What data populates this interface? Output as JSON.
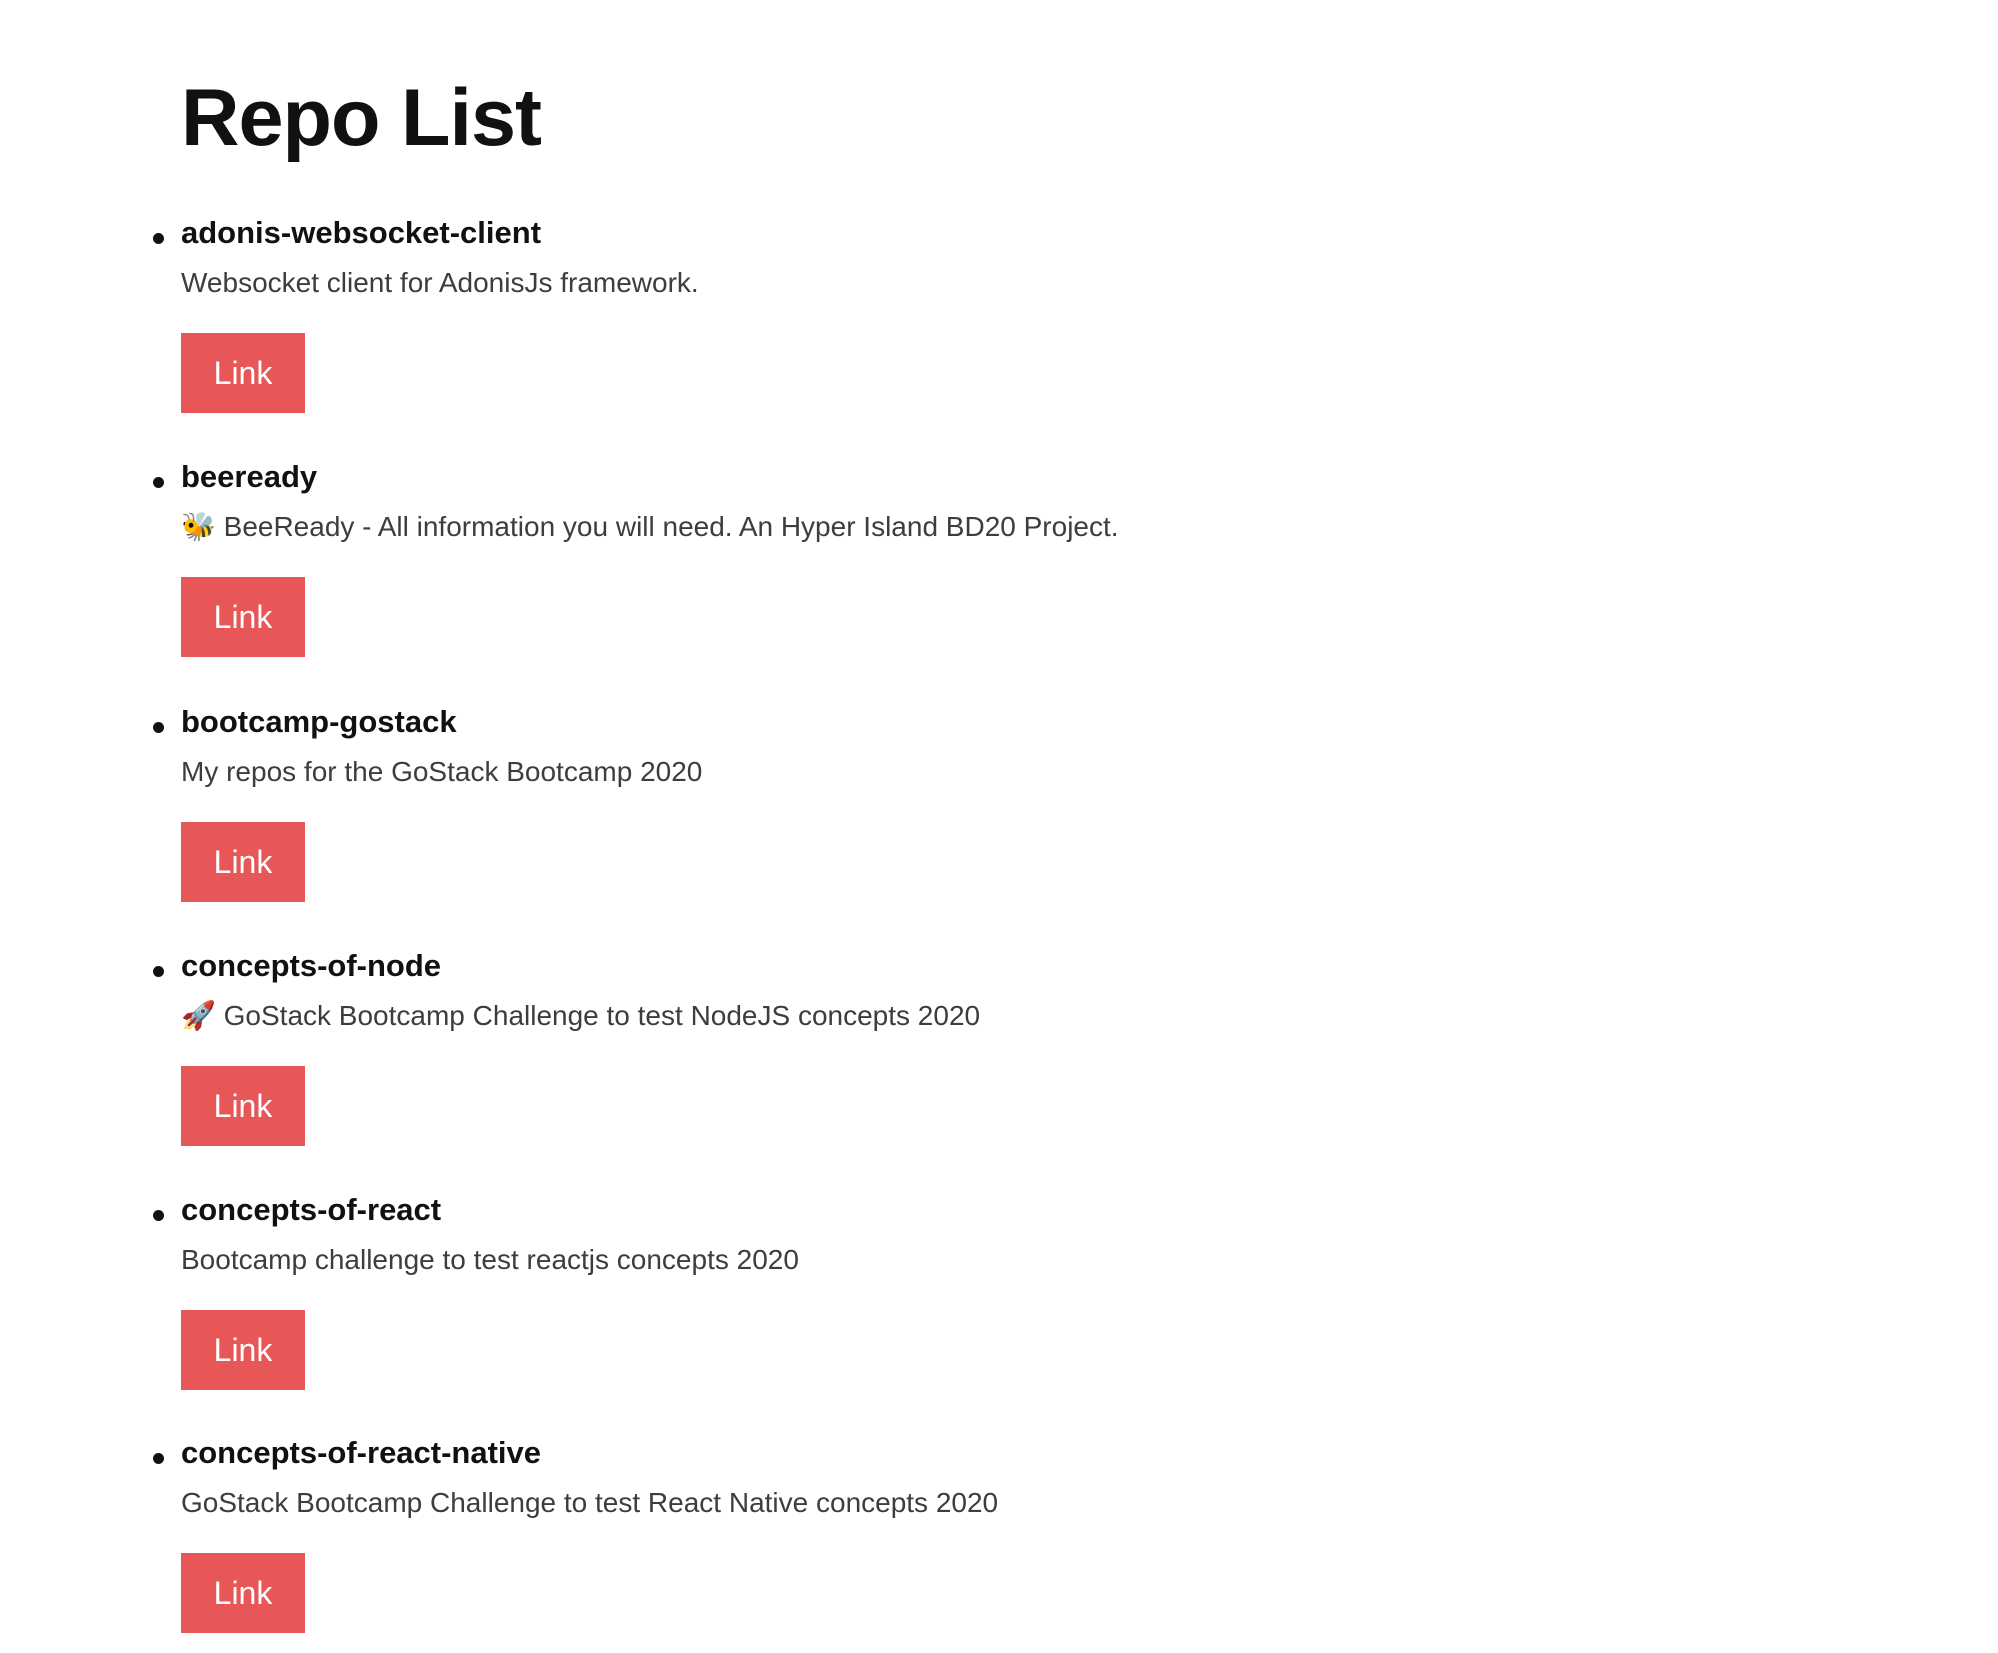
{
  "page": {
    "title": "Repo List"
  },
  "repos": [
    {
      "name": "adonis-websocket-client",
      "description": "Websocket client for AdonisJs framework.",
      "link_label": "Link"
    },
    {
      "name": "beeready",
      "description": "🐝 BeeReady - All information you will need. An Hyper Island BD20 Project.",
      "link_label": "Link"
    },
    {
      "name": "bootcamp-gostack",
      "description": "My repos for the GoStack Bootcamp 2020",
      "link_label": "Link"
    },
    {
      "name": "concepts-of-node",
      "description": "🚀 GoStack Bootcamp Challenge to test NodeJS concepts 2020",
      "link_label": "Link"
    },
    {
      "name": "concepts-of-react",
      "description": "Bootcamp challenge to test reactjs concepts 2020",
      "link_label": "Link"
    },
    {
      "name": "concepts-of-react-native",
      "description": "GoStack Bootcamp Challenge to test React Native concepts 2020",
      "link_label": "Link"
    }
  ],
  "colors": {
    "link_button_bg": "#e85758",
    "link_button_text": "#ffffff",
    "heading_text": "#111111",
    "description_text": "#3d3d3d"
  }
}
